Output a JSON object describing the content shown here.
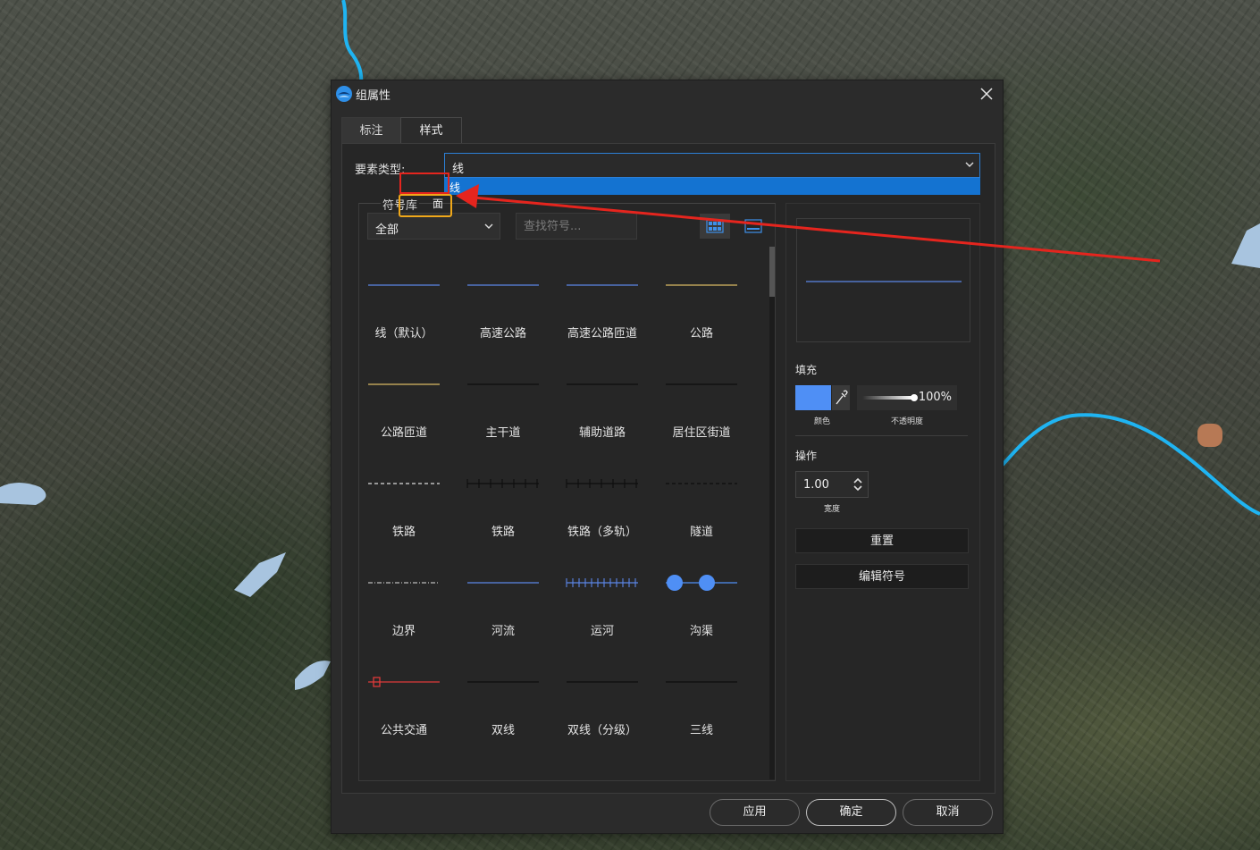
{
  "dialog": {
    "title": "组属性",
    "tabs": [
      {
        "label": "标注",
        "active": false
      },
      {
        "label": "样式",
        "active": true
      }
    ]
  },
  "feature_type": {
    "label": "要素类型:",
    "selected": "线",
    "options": [
      "线",
      "面"
    ]
  },
  "symbols": {
    "group_label": "符号库",
    "category": "全部",
    "search_placeholder": "查找符号...",
    "items": [
      {
        "name": "线（默认）",
        "style": "solid",
        "color": "#5b86e6"
      },
      {
        "name": "高速公路",
        "style": "solid",
        "color": "#5b86e6"
      },
      {
        "name": "高速公路匝道",
        "style": "solid",
        "color": "#5b86e6"
      },
      {
        "name": "公路",
        "style": "solid",
        "color": "#d9b964"
      },
      {
        "name": "公路匝道",
        "style": "solid",
        "color": "#d9b964"
      },
      {
        "name": "主干道",
        "style": "solid",
        "color": "#0e0e0e"
      },
      {
        "name": "辅助道路",
        "style": "solid",
        "color": "#0e0e0e"
      },
      {
        "name": "居住区街道",
        "style": "solid",
        "color": "#0e0e0e"
      },
      {
        "name": "铁路",
        "style": "dashed",
        "color": "#dddddd"
      },
      {
        "name": "铁路",
        "style": "ticks",
        "color": "#0e0e0e"
      },
      {
        "name": "铁路（多轨）",
        "style": "ticks",
        "color": "#0e0e0e"
      },
      {
        "name": "隧道",
        "style": "dashed",
        "color": "#0e0e0e"
      },
      {
        "name": "边界",
        "style": "dashdot",
        "color": "#bbbbbb"
      },
      {
        "name": "河流",
        "style": "solid",
        "color": "#5b86e6"
      },
      {
        "name": "运河",
        "style": "ticks-dense",
        "color": "#5b86e6"
      },
      {
        "name": "沟渠",
        "style": "dots",
        "color": "#4f8ff5"
      },
      {
        "name": "公共交通",
        "style": "transit",
        "color": "#e03a3a"
      },
      {
        "name": "双线",
        "style": "solid",
        "color": "#0e0e0e"
      },
      {
        "name": "双线（分级）",
        "style": "solid",
        "color": "#0e0e0e"
      },
      {
        "name": "三线",
        "style": "solid",
        "color": "#0e0e0e"
      }
    ]
  },
  "style_panel": {
    "preview_color": "#5b86e6",
    "fill_label": "填充",
    "fill_color": "#4f8ff5",
    "color_caption": "颜色",
    "opacity_value": "100%",
    "opacity_caption": "不透明度",
    "operation_label": "操作",
    "width_value": "1.00",
    "width_caption": "宽度",
    "reset_label": "重置",
    "edit_symbol_label": "编辑符号"
  },
  "footer": {
    "apply_label": "应用",
    "ok_label": "确定",
    "cancel_label": "取消"
  },
  "colors": {
    "dialog_bg": "#2b2b2b",
    "accent": "#1473d1",
    "annotation_red": "#e5251e",
    "annotation_orange": "#f0a81a",
    "river": "#1fb4f2"
  }
}
